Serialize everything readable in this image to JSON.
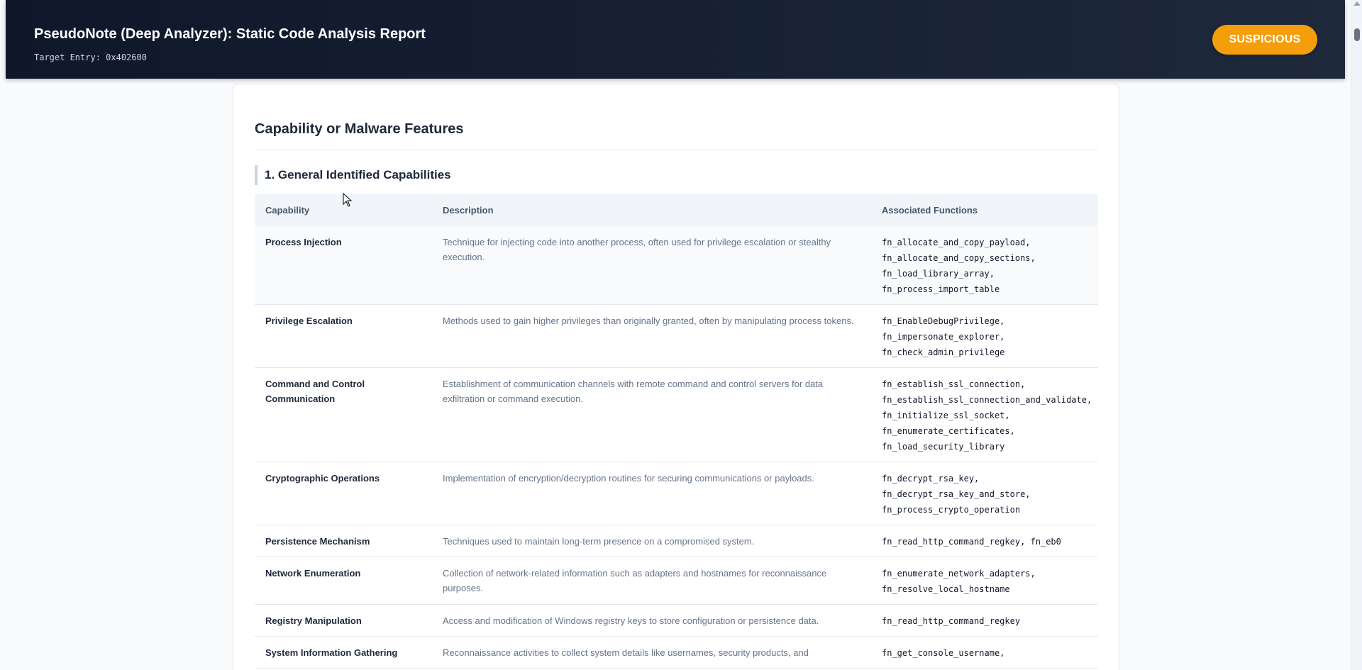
{
  "header": {
    "title": "PseudoNote (Deep Analyzer): Static Code Analysis Report",
    "target_label": "Target Entry: 0x402600",
    "verdict": "SUSPICIOUS"
  },
  "colors": {
    "verdict": "#f59e0b",
    "header_bg": "#0f172a",
    "accent_bar": "#cbd5e1"
  },
  "report": {
    "section_title": "Capability or Malware Features",
    "subsection_title": "1. General Identified Capabilities",
    "table": {
      "headers": [
        "Capability",
        "Description",
        "Associated Functions"
      ],
      "rows": [
        {
          "capability": "Process Injection",
          "description": "Technique for injecting code into another process, often used for privilege escalation or stealthy execution.",
          "functions": [
            "fn_allocate_and_copy_payload,",
            "fn_allocate_and_copy_sections,",
            "fn_load_library_array,",
            "fn_process_import_table"
          ]
        },
        {
          "capability": "Privilege Escalation",
          "description": "Methods used to gain higher privileges than originally granted, often by manipulating process tokens.",
          "functions": [
            "fn_EnableDebugPrivilege,",
            "fn_impersonate_explorer,",
            "fn_check_admin_privilege"
          ]
        },
        {
          "capability": "Command and Control Communication",
          "description": "Establishment of communication channels with remote command and control servers for data exfiltration or command execution.",
          "functions": [
            "fn_establish_ssl_connection,",
            "fn_establish_ssl_connection_and_validate,",
            "fn_initialize_ssl_socket,",
            "fn_enumerate_certificates,",
            "fn_load_security_library"
          ]
        },
        {
          "capability": "Cryptographic Operations",
          "description": "Implementation of encryption/decryption routines for securing communications or payloads.",
          "functions": [
            "fn_decrypt_rsa_key,",
            "fn_decrypt_rsa_key_and_store,",
            "fn_process_crypto_operation"
          ]
        },
        {
          "capability": "Persistence Mechanism",
          "description": "Techniques used to maintain long-term presence on a compromised system.",
          "functions": [
            "fn_read_http_command_regkey, fn_eb0"
          ]
        },
        {
          "capability": "Network Enumeration",
          "description": "Collection of network-related information such as adapters and hostnames for reconnaissance purposes.",
          "functions": [
            "fn_enumerate_network_adapters,",
            "fn_resolve_local_hostname"
          ]
        },
        {
          "capability": "Registry Manipulation",
          "description": "Access and modification of Windows registry keys to store configuration or persistence data.",
          "functions": [
            "fn_read_http_command_regkey"
          ]
        },
        {
          "capability": "System Information Gathering",
          "description": "Reconnaissance activities to collect system details like usernames, security products, and",
          "functions": [
            "fn_get_console_username,"
          ]
        }
      ]
    }
  }
}
